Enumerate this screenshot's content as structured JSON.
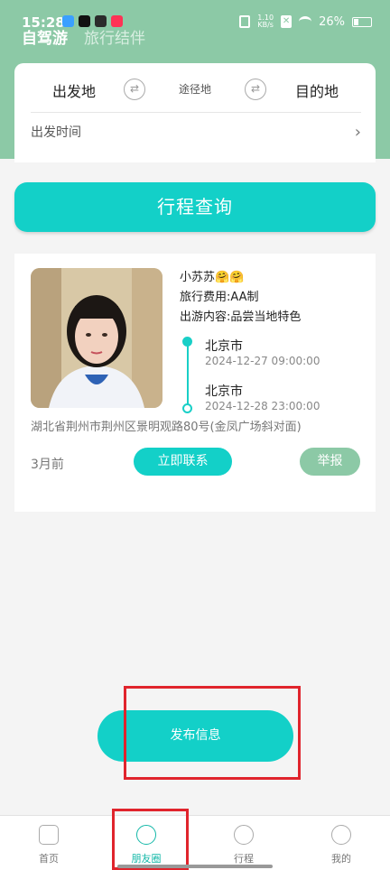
{
  "status_bar": {
    "time": "15:28",
    "net_speed_top": "1.10",
    "net_speed_unit": "KB/s",
    "battery": "26%"
  },
  "app_tabs": [
    "自驾游",
    "旅行结伴"
  ],
  "search": {
    "from": "出发地",
    "via": "途径地",
    "to": "目的地",
    "depart_time": "出发时间"
  },
  "query_button": "行程查询",
  "trip": {
    "name": "小苏苏🤗🤗",
    "fee": "旅行费用:AA制",
    "content": "出游内容:品尝当地特色",
    "start_city": "北京市",
    "start_time": "2024-12-27 09:00:00",
    "end_city": "北京市",
    "end_time": "2024-12-28 23:00:00",
    "address": "湖北省荆州市荆州区景明观路80号(金凤广场斜对面)",
    "posted_ago": "3月前",
    "contact_button": "立即联系",
    "report_button": "举报"
  },
  "publish_button": "发布信息",
  "bottom_nav": [
    {
      "label": "首页",
      "icon": "home-icon"
    },
    {
      "label": "朋友圈",
      "icon": "compass-icon"
    },
    {
      "label": "行程",
      "icon": "compass-icon"
    },
    {
      "label": "我的",
      "icon": "user-icon"
    }
  ],
  "colors": {
    "header": "#8cc9a6",
    "accent": "#13d0c8",
    "highlight": "#e0242c"
  }
}
